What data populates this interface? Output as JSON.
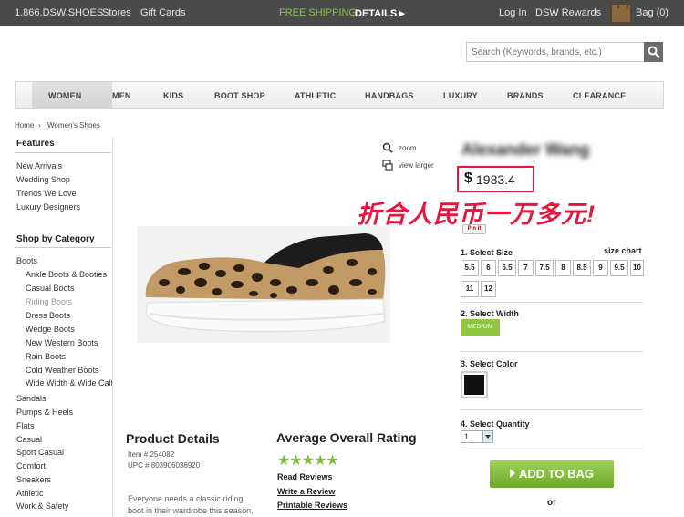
{
  "topbar": {
    "phone": "1.866.DSW.SHOES",
    "stores": "Stores",
    "gift_cards": "Gift Cards",
    "free_shipping": "FREE SHIPPING",
    "details": "DETAILS ▸",
    "login": "Log In",
    "rewards": "DSW Rewards",
    "bag": "Bag (0)"
  },
  "search": {
    "placeholder": "Search (Keywords, brands, etc.)"
  },
  "nav": {
    "items": [
      "WOMEN",
      "MEN",
      "KIDS",
      "BOOT SHOP",
      "ATHLETIC",
      "HANDBAGS",
      "LUXURY",
      "BRANDS",
      "CLEARANCE"
    ],
    "active": "WOMEN"
  },
  "breadcrumb": [
    "Home",
    "Women's Shoes"
  ],
  "sidebar": {
    "features_title": "Features",
    "features": [
      "New Arrivals",
      "Wedding Shop",
      "Trends We Love",
      "Luxury Designers"
    ],
    "category_title": "Shop by Category",
    "boots": "Boots",
    "boot_types": [
      "Ankle Boots & Booties",
      "Casual Boots",
      "Riding Boots",
      "Dress Boots",
      "Wedge Boots",
      "New Western Boots",
      "Rain Boots",
      "Cold Weather Boots",
      "Wide Width & Wide Calf"
    ],
    "categories": [
      "Sandals",
      "Pumps & Heels",
      "Flats",
      "Casual",
      "Sport Casual",
      "Comfort",
      "Sneakers",
      "Athletic",
      "Work & Safety"
    ]
  },
  "image_tools": {
    "zoom": "zoom",
    "view_larger": "view larger"
  },
  "product": {
    "brand": "Alexander Wang",
    "currency": "$",
    "price": "1983.4",
    "annotation": "折合人民币一万多元!",
    "pin_it": "Pin it",
    "select_size_label": "1. Select Size",
    "size_chart": "size chart",
    "sizes": [
      "5.5",
      "6",
      "6.5",
      "7",
      "7.5",
      "8",
      "8.5",
      "9",
      "9.5",
      "10",
      "11",
      "12"
    ],
    "select_width_label": "2. Select Width",
    "width": "MEDIUM",
    "select_color_label": "3. Select Color",
    "color": "#111111",
    "select_quantity_label": "4. Select Quantity",
    "quantity": "1",
    "add_to_bag": "ADD TO BAG",
    "or": "or"
  },
  "details": {
    "title": "Product Details",
    "item_no": "Item # 254082",
    "upc": "UPC # 803906038920",
    "desc_line1": "Everyone needs a classic riding",
    "desc_line2": "boot in their wardrobe this season,"
  },
  "rating": {
    "title": "Average Overall Rating",
    "stars": "★★★★★",
    "read_reviews": "Read Reviews",
    "write_review": "Write a Review",
    "printable_reviews": "Printable Reviews"
  },
  "colors": {
    "accent_green": "#8ec63f",
    "annotation_red": "#e8163f",
    "topbar": "#4a4a4a"
  }
}
